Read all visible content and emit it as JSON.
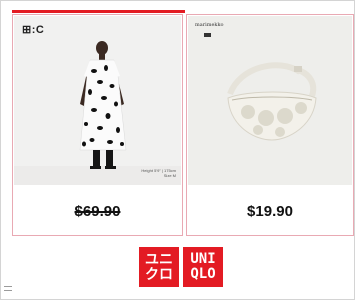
{
  "products": [
    {
      "brand": "⊞:C",
      "model_note": "Height 5'9\" | 175cm Size M",
      "price": "$69.90",
      "price_struck": true
    },
    {
      "brand": "marimekko",
      "price": "$19.90",
      "price_struck": false
    }
  ],
  "logo": {
    "katakana": "ユニ\nクロ",
    "latin": "UNI\nQLO",
    "color": "#e31b23"
  },
  "accent_color": "#e31b23"
}
